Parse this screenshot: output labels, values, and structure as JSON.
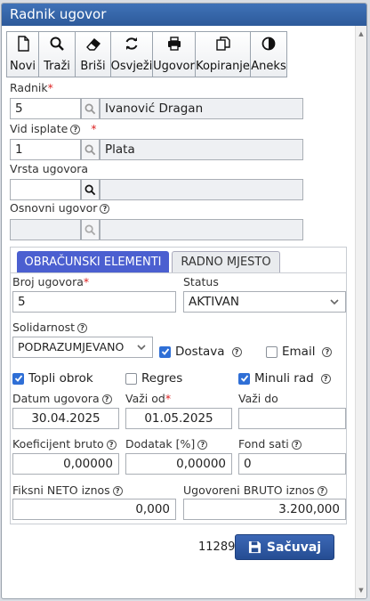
{
  "window": {
    "title": "Radnik ugovor"
  },
  "toolbar": [
    {
      "key": "novi",
      "label": "Novi",
      "icon": "new-document-icon"
    },
    {
      "key": "trazi",
      "label": "Traži",
      "icon": "search-icon"
    },
    {
      "key": "brisi",
      "label": "Briši",
      "icon": "eraser-icon"
    },
    {
      "key": "osvjezi",
      "label": "Osvježi",
      "icon": "refresh-icon"
    },
    {
      "key": "ugovor",
      "label": "Ugovor",
      "icon": "printer-icon"
    },
    {
      "key": "kopiranje",
      "label": "Kopiranje",
      "icon": "copy-icon"
    },
    {
      "key": "aneks",
      "label": "Aneks",
      "icon": "contrast-icon"
    }
  ],
  "form": {
    "radnik": {
      "label": "Radnik",
      "code": "5",
      "name": "Ivanović Dragan"
    },
    "vid_isplate": {
      "label": "Vid isplate",
      "code": "1",
      "name": "Plata"
    },
    "vrsta_ugovora": {
      "label": "Vrsta ugovora",
      "code": "",
      "name": ""
    },
    "osnovni_ugovor": {
      "label": "Osnovni ugovor",
      "code": "",
      "name": ""
    }
  },
  "tabs": {
    "active": "OBRAČUNSKI ELEMENTI",
    "inactive": "RADNO MJESTO"
  },
  "obracun": {
    "broj_ugovora": {
      "label": "Broj ugovora",
      "value": "5"
    },
    "status": {
      "label": "Status",
      "value": "AKTIVAN"
    },
    "solidarnost": {
      "label": "Solidarnost",
      "value": "PODRAZUMJEVANO"
    },
    "dostava": {
      "label": "Dostava",
      "checked": true
    },
    "email": {
      "label": "Email",
      "checked": false
    },
    "topli_obrok": {
      "label": "Topli obrok",
      "checked": true
    },
    "regres": {
      "label": "Regres",
      "checked": false
    },
    "minuli_rad": {
      "label": "Minuli rad",
      "checked": true
    },
    "datum_ugovora": {
      "label": "Datum ugovora",
      "value": "30.04.2025"
    },
    "vazi_od": {
      "label": "Važi od",
      "value": "01.05.2025"
    },
    "vazi_do": {
      "label": "Važi do",
      "value": ""
    },
    "koeficijent_bruto": {
      "label": "Koeficijent bruto",
      "value": "0,00000"
    },
    "dodatak": {
      "label": "Dodatak [%]",
      "value": "0,00000"
    },
    "fond_sati": {
      "label": "Fond sati",
      "value": "0"
    },
    "fiksni_neto": {
      "label": "Fiksni NETO iznos",
      "value": "0,000"
    },
    "ugovoreni_bruto": {
      "label": "Ugovoreni BRUTO iznos",
      "value": "3.200,000"
    }
  },
  "footer": {
    "record_id": "11289",
    "save_label": "Sačuvaj"
  },
  "colors": {
    "titlebar": "#2d5a9a",
    "tab_active": "#4b5fd0",
    "save_button": "#254d93",
    "checkbox": "#2f6fd6"
  }
}
